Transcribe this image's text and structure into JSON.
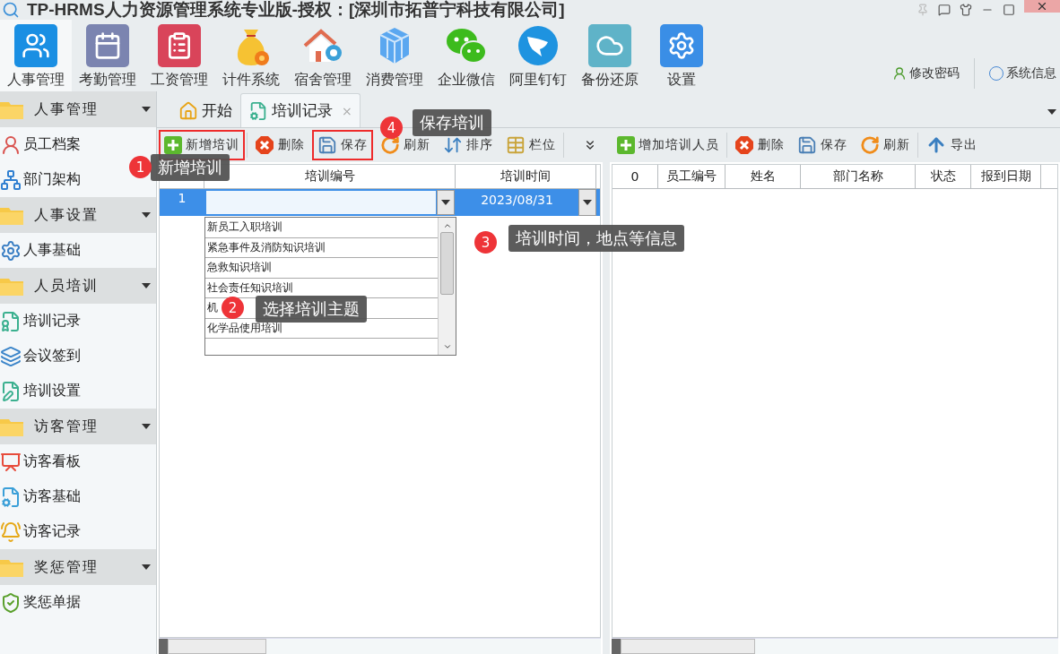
{
  "window": {
    "title": "TP-HRMS人力资源管理系统专业版-授权：[深圳市拓普宁科技有限公司]"
  },
  "modules": [
    {
      "label": "人事管理",
      "selected": true
    },
    {
      "label": "考勤管理",
      "selected": false
    },
    {
      "label": "工资管理",
      "selected": false
    },
    {
      "label": "计件系统",
      "selected": false
    },
    {
      "label": "宿舍管理",
      "selected": false
    },
    {
      "label": "消费管理",
      "selected": false
    },
    {
      "label": "企业微信",
      "selected": false
    },
    {
      "label": "阿里钉钉",
      "selected": false
    },
    {
      "label": "备份还原",
      "selected": false
    },
    {
      "label": "设置",
      "selected": false
    }
  ],
  "user_links": [
    "修改密码",
    "系统信息"
  ],
  "sidebar": {
    "groups": [
      {
        "label": "人事管理",
        "items": [
          "员工档案",
          "部门架构"
        ]
      },
      {
        "label": "人事设置",
        "items": [
          "人事基础"
        ]
      },
      {
        "label": "人员培训",
        "items": [
          "培训记录",
          "会议签到",
          "培训设置"
        ]
      },
      {
        "label": "访客管理",
        "items": [
          "访客看板",
          "访客基础",
          "访客记录"
        ]
      },
      {
        "label": "奖惩管理",
        "items": [
          "奖惩单据"
        ]
      }
    ]
  },
  "tabs": [
    {
      "label": "开始",
      "selected": false,
      "closable": false
    },
    {
      "label": "培训记录",
      "selected": true,
      "closable": true,
      "close_mark": "×"
    }
  ],
  "training_panel": {
    "toolbar": [
      {
        "label": "新增培训",
        "kind": "add",
        "highlighted": true
      },
      {
        "label": "删除",
        "kind": "delete",
        "highlighted": false
      },
      {
        "label": "保存",
        "kind": "save",
        "highlighted": true
      },
      {
        "label": "刷新",
        "kind": "refresh",
        "highlighted": false
      },
      {
        "label": "排序",
        "kind": "sort",
        "highlighted": false
      },
      {
        "label": "栏位",
        "kind": "columns",
        "highlighted": false
      }
    ],
    "columns": [
      "培训编号",
      "培训时间"
    ],
    "rows": [
      {
        "number": "1",
        "date": "2023/08/31",
        "selected": true
      }
    ],
    "dropdown": {
      "options": [
        "新员工入职培训",
        "紧急事件及消防知识培训",
        "急救知识培训",
        "社会责任知识培训",
        "机",
        "化学品使用培训"
      ]
    }
  },
  "attendee_panel": {
    "toolbar": [
      {
        "label": "增加培训人员",
        "kind": "add"
      },
      {
        "label": "删除",
        "kind": "delete"
      },
      {
        "label": "保存",
        "kind": "save"
      },
      {
        "label": "刷新",
        "kind": "refresh"
      },
      {
        "label": "导出",
        "kind": "export"
      }
    ],
    "columns": [
      "0",
      "员工编号",
      "姓名",
      "部门名称",
      "状态",
      "报到日期"
    ]
  },
  "callouts": [
    {
      "number": "1",
      "text": "新增培训"
    },
    {
      "number": "2",
      "text": "选择培训主题"
    },
    {
      "number": "3",
      "text": "培训时间，地点等信息"
    },
    {
      "number": "4",
      "text": "保存培训"
    }
  ]
}
